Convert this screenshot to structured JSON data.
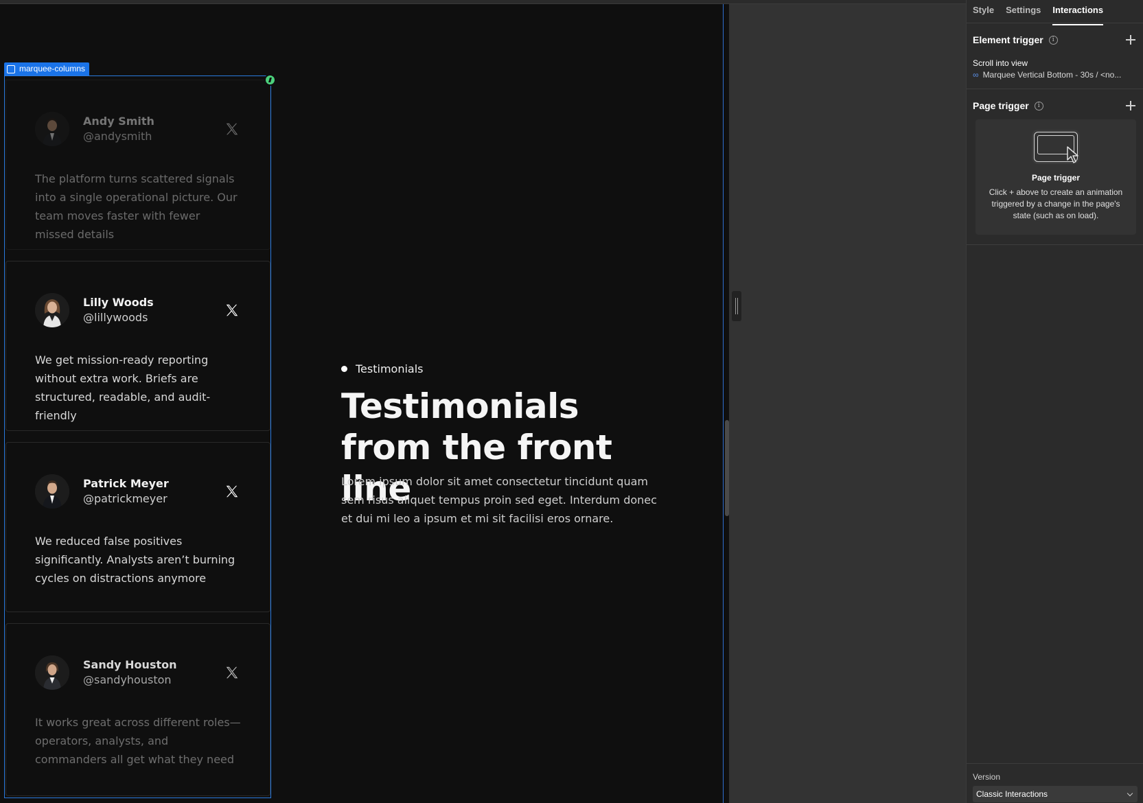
{
  "canvas": {
    "selection_label": "marquee-columns",
    "section_tag": "Testimonials",
    "hero_title": "Testimonials from the front line",
    "hero_body": "Lorem ipsum dolor sit amet consectetur tincidunt quam sem risus aliquet tempus proin sed eget. Interdum donec et dui mi leo a ipsum et mi sit facilisi eros ornare.",
    "cards": [
      {
        "name": "Andy Smith",
        "handle": "@andysmith",
        "quote": "The platform turns scattered signals into a single operational picture. Our team moves faster with fewer missed details",
        "icon": "x-logo-icon"
      },
      {
        "name": "Lilly Woods",
        "handle": "@lillywoods",
        "quote": "We get mission-ready reporting without extra work. Briefs are structured, readable, and audit-friendly",
        "icon": "x-logo-icon"
      },
      {
        "name": "Patrick Meyer",
        "handle": "@patrickmeyer",
        "quote": "We reduced false positives significantly. Analysts aren’t burning cycles on distractions anymore",
        "icon": "x-logo-icon"
      },
      {
        "name": "Sandy Houston",
        "handle": "@sandyhouston",
        "quote": "It works great across different roles—operators, analysts, and commanders all get what they need",
        "icon": "x-logo-icon"
      }
    ]
  },
  "panel": {
    "tabs": [
      "Style",
      "Settings",
      "Interactions"
    ],
    "active_tab": "Interactions",
    "element_trigger": {
      "title": "Element trigger",
      "event": "Scroll into view",
      "animation": "Marquee Vertical Bottom - 30s / <no..."
    },
    "page_trigger": {
      "title": "Page trigger",
      "empty_title": "Page trigger",
      "empty_text": "Click + above to create an animation triggered by a change in the page's state (such as on load)."
    },
    "version": {
      "label": "Version",
      "value": "Classic Interactions"
    }
  },
  "colors": {
    "accent_blue": "#1a73e8",
    "selection_dot": "#4bd17c",
    "canvas_bg": "#0f0f0f",
    "panel_bg": "#2b2b2b"
  }
}
